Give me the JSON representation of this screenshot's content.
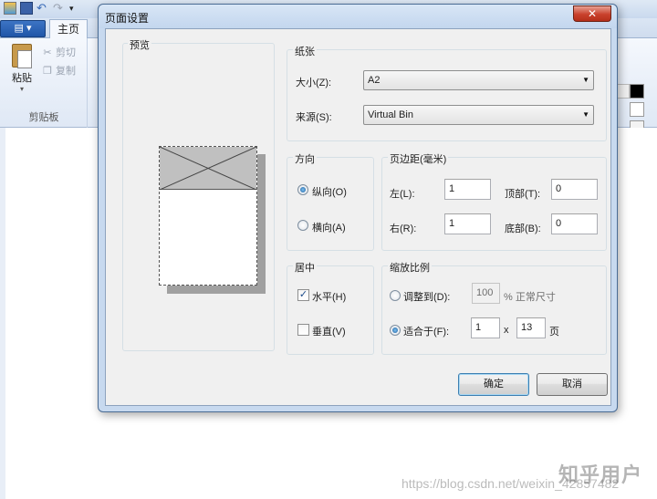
{
  "background": {
    "title_text": "",
    "app_menu_label": "▤ ▾",
    "tabs": [
      "主页"
    ],
    "clipboard": {
      "paste_label": "粘贴",
      "cut_label": "剪切",
      "copy_label": "复制",
      "group_label": "剪贴板"
    },
    "watermark_main": "知乎用户",
    "watermark_url": "https://blog.csdn.net/weixin_42857482"
  },
  "dialog": {
    "title": "页面设置",
    "close_glyph": "✕",
    "preview": {
      "title": "预览"
    },
    "paper": {
      "title": "纸张",
      "size_label": "大小(Z):",
      "size_value": "A2",
      "source_label": "来源(S):",
      "source_value": "Virtual Bin"
    },
    "orientation": {
      "title": "方向",
      "portrait_label": "纵向(O)",
      "portrait_checked": true,
      "landscape_label": "横向(A)",
      "landscape_checked": false
    },
    "margins": {
      "title": "页边距(毫米)",
      "left_label": "左(L):",
      "left_value": "1",
      "top_label": "顶部(T):",
      "top_value": "0",
      "right_label": "右(R):",
      "right_value": "1",
      "bottom_label": "底部(B):",
      "bottom_value": "0"
    },
    "centering": {
      "title": "居中",
      "horizontal_label": "水平(H)",
      "horizontal_checked": true,
      "vertical_label": "垂直(V)",
      "vertical_checked": false
    },
    "scaling": {
      "title": "缩放比例",
      "adjust_label": "调整到(D):",
      "adjust_value": "100",
      "adjust_suffix": "% 正常尺寸",
      "adjust_checked": false,
      "fit_label": "适合于(F):",
      "fit_checked": true,
      "fit_wide": "1",
      "fit_x": "x",
      "fit_tall": "13",
      "fit_suffix": "页"
    },
    "ok_label": "确定",
    "cancel_label": "取消"
  }
}
